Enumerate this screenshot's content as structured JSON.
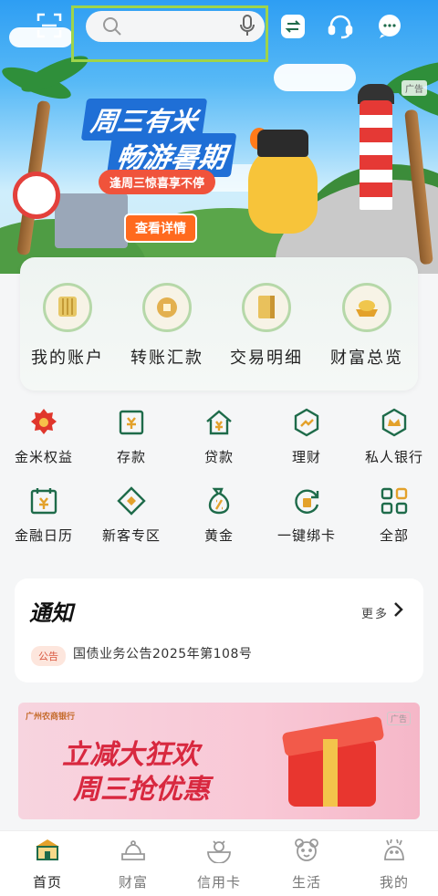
{
  "hero": {
    "title_line1": "周三有米",
    "title_line2": "畅游暑期",
    "subtitle": "逢周三惊喜享不停",
    "button": "查看详情",
    "ad_tag": "广告"
  },
  "quick_actions": [
    {
      "label": "我的账户",
      "icon": "account-icon"
    },
    {
      "label": "转账汇款",
      "icon": "transfer-icon"
    },
    {
      "label": "交易明细",
      "icon": "transactions-icon"
    },
    {
      "label": "财富总览",
      "icon": "wealth-icon"
    }
  ],
  "grid_row1": [
    {
      "label": "金米权益",
      "icon": "rights-icon"
    },
    {
      "label": "存款",
      "icon": "deposit-icon"
    },
    {
      "label": "贷款",
      "icon": "loan-icon"
    },
    {
      "label": "理财",
      "icon": "finance-icon"
    },
    {
      "label": "私人银行",
      "icon": "private-bank-icon"
    }
  ],
  "grid_row2": [
    {
      "label": "金融日历",
      "icon": "calendar-icon"
    },
    {
      "label": "新客专区",
      "icon": "new-customer-icon"
    },
    {
      "label": "黄金",
      "icon": "gold-icon"
    },
    {
      "label": "一键绑卡",
      "icon": "bind-card-icon"
    },
    {
      "label": "全部",
      "icon": "all-icon"
    }
  ],
  "notice": {
    "title": "通知",
    "more": "更多",
    "tag": "公告",
    "text": "国债业务公告2025年第108号"
  },
  "promo": {
    "logo_text": "广州农商银行",
    "ad_tag": "广告",
    "line1": "立减大狂欢",
    "line2": "周三抢优惠"
  },
  "bottom_nav": [
    {
      "label": "首页",
      "active": true
    },
    {
      "label": "财富",
      "active": false
    },
    {
      "label": "信用卡",
      "active": false
    },
    {
      "label": "生活",
      "active": false
    },
    {
      "label": "我的",
      "active": false
    }
  ],
  "colors": {
    "accent_green": "#1e6b4a",
    "accent_gold": "#e3a12b",
    "highlight_border": "#9fd44a",
    "promo_red": "#d8283f"
  }
}
